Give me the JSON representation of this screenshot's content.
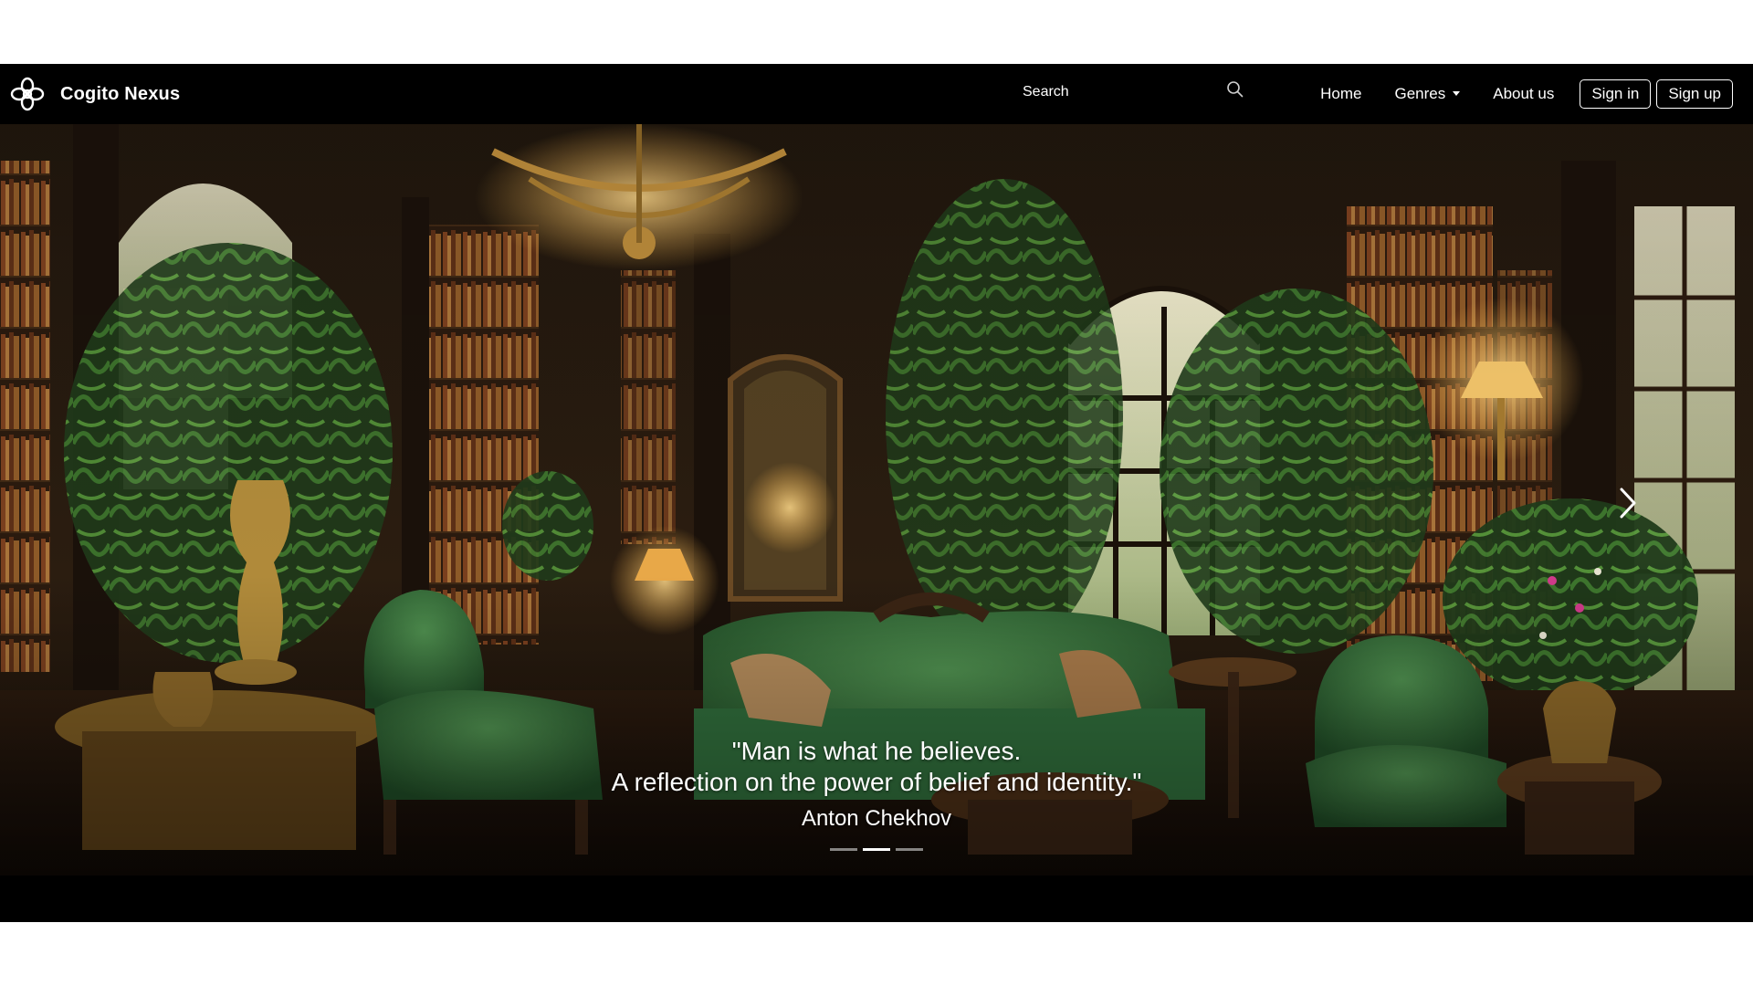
{
  "brand": {
    "name": "Cogito Nexus",
    "logo_icon": "celtic-knot-logo-icon"
  },
  "search": {
    "placeholder": "Search",
    "icon": "search-icon"
  },
  "nav": {
    "home": "Home",
    "genres": "Genres",
    "about": "About us",
    "sign_in": "Sign in",
    "sign_up": "Sign up"
  },
  "carousel": {
    "quote_line1": "\"Man is what he believes.",
    "quote_line2": "A reflection on the power of belief and identity.\"",
    "author": "Anton Chekhov",
    "active_slide": 2,
    "slide_count": 3,
    "prev_icon": "chevron-left-icon",
    "next_icon": "chevron-right-icon"
  },
  "colors": {
    "navbar_bg": "#000000",
    "text": "#ffffff",
    "velvet_green": "#2f6b3a",
    "wood_dark": "#3a2414",
    "brass": "#c9a14a"
  }
}
